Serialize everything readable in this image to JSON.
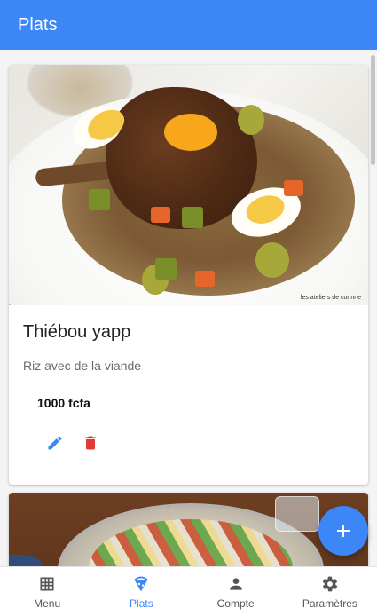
{
  "appbar": {
    "title": "Plats"
  },
  "dishes": [
    {
      "name": "Thiébou yapp",
      "description": "Riz avec de la viande",
      "price": "1000 fcfa",
      "photo_watermark": "les ateliers de corinne"
    }
  ],
  "nav": {
    "items": [
      {
        "label": "Menu",
        "icon": "grid-icon",
        "active": false
      },
      {
        "label": "Plats",
        "icon": "pizza-icon",
        "active": true
      },
      {
        "label": "Compte",
        "icon": "person-icon",
        "active": false
      },
      {
        "label": "Paramètres",
        "icon": "gear-icon",
        "active": false
      }
    ]
  },
  "fab": {
    "icon": "plus-icon"
  },
  "colors": {
    "primary": "#3d86f6",
    "delete": "#e53935",
    "edit": "#3d86f6",
    "nav_inactive": "#555555"
  }
}
